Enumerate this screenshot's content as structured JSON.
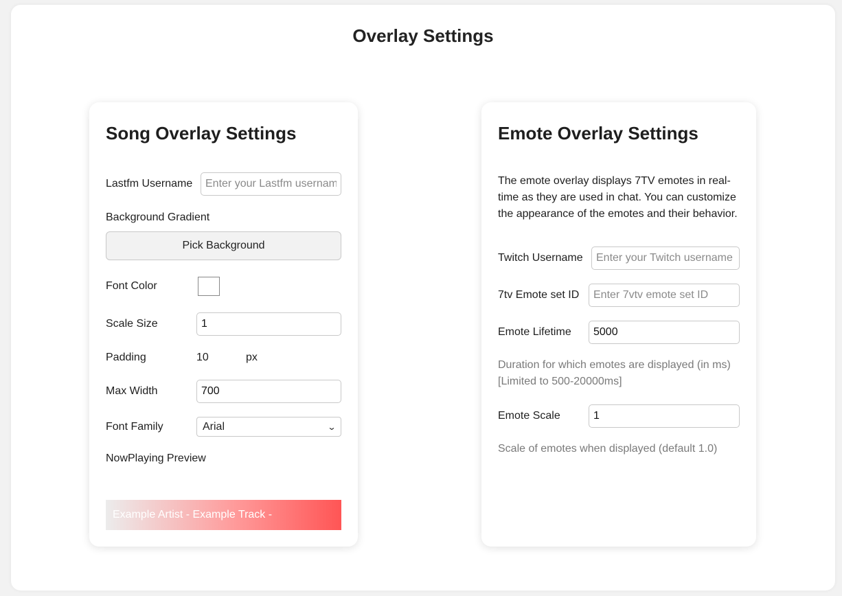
{
  "page": {
    "title": "Overlay Settings"
  },
  "song": {
    "title": "Song Overlay Settings",
    "lastfm_label": "Lastfm Username",
    "lastfm_placeholder": "Enter your Lastfm username",
    "background_label": "Background Gradient",
    "pick_background_label": "Pick Background",
    "font_color_label": "Font Color",
    "font_color_value": "#ffffff",
    "scale_label": "Scale Size",
    "scale_value": "1",
    "padding_label": "Padding",
    "padding_value": "10",
    "padding_unit": "px",
    "max_width_label": "Max Width",
    "max_width_value": "700",
    "font_family_label": "Font Family",
    "font_family_value": "Arial",
    "preview_label": "NowPlaying Preview",
    "preview_text": "Example Artist - Example Track -"
  },
  "emote": {
    "title": "Emote Overlay Settings",
    "description": "The emote overlay displays 7TV emotes in real-time as they are used in chat. You can customize the appearance of the emotes and their behavior.",
    "twitch_label": "Twitch Username",
    "twitch_placeholder": "Enter your Twitch username",
    "set_id_label": "7tv Emote set ID",
    "set_id_placeholder": "Enter 7vtv emote set ID",
    "lifetime_label": "Emote Lifetime",
    "lifetime_value": "5000",
    "lifetime_hint": "Duration for which emotes are displayed (in ms) [Limited to 500-20000ms]",
    "scale_label": "Emote Scale",
    "scale_value": "1",
    "scale_hint": "Scale of emotes when displayed (default 1.0)"
  }
}
